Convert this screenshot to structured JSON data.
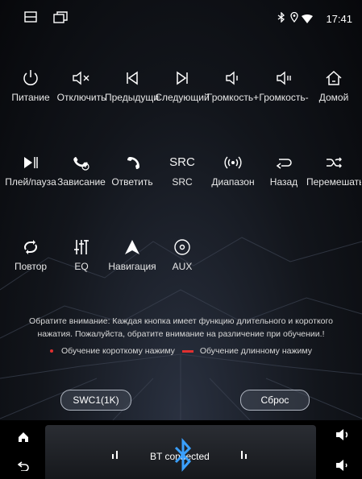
{
  "status": {
    "time": "17:41",
    "icons": [
      "menu-icon",
      "windows-icon",
      "bluetooth-icon",
      "location-icon",
      "wifi-icon"
    ]
  },
  "buttons": [
    {
      "label": "Питание",
      "icon": "power-icon"
    },
    {
      "label": "Отключить",
      "icon": "mute-icon"
    },
    {
      "label": "Предыдущий",
      "icon": "previous-icon"
    },
    {
      "label": "Следующий",
      "icon": "next-icon"
    },
    {
      "label": "Громкость+",
      "icon": "volume-up-icon"
    },
    {
      "label": "Громкость-",
      "icon": "volume-down-icon"
    },
    {
      "label": "Домой",
      "icon": "home-icon"
    },
    {
      "label": "Плей/пауза",
      "icon": "play-pause-icon"
    },
    {
      "label": "Зависание",
      "icon": "hangup-icon"
    },
    {
      "label": "Ответить",
      "icon": "answer-icon"
    },
    {
      "label": "SRC",
      "icon": "src-icon",
      "glyph": "SRC"
    },
    {
      "label": "Диапазон",
      "icon": "band-icon"
    },
    {
      "label": "Назад",
      "icon": "back-icon"
    },
    {
      "label": "Перемешать",
      "icon": "shuffle-icon"
    },
    {
      "label": "Повтор",
      "icon": "repeat-icon"
    },
    {
      "label": "EQ",
      "icon": "eq-icon"
    },
    {
      "label": "Навигация",
      "icon": "navigation-icon"
    },
    {
      "label": "AUX",
      "icon": "aux-icon"
    }
  ],
  "notice": {
    "line1": "Обратите внимание: Каждая кнопка имеет функцию длительного и короткого",
    "line2": "нажатия. Пожалуйста, обратите внимание на различение при обучении.!"
  },
  "legend": {
    "short": "Обучение короткому нажиму",
    "long": "Обучение длинному нажиму",
    "color": "#e03030"
  },
  "actions": {
    "swc": "SWC1(1K)",
    "reset": "Сброс"
  },
  "dock": {
    "bt_status": "BT connected"
  },
  "colors": {
    "accent": "#3aa0ff",
    "background": "#0a0c10"
  }
}
